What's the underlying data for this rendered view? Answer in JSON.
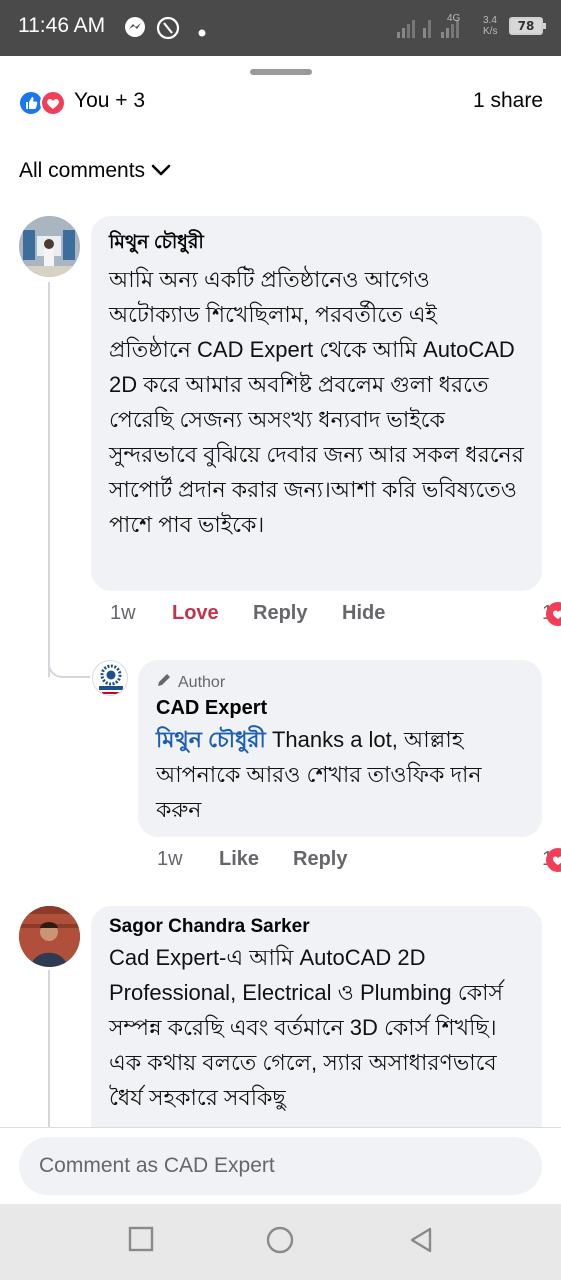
{
  "status_bar": {
    "time": "11:46 AM",
    "network_label": "4G",
    "speed": "3.4",
    "speed_unit": "K/s",
    "battery": "78"
  },
  "reactions": {
    "summary": "You + 3",
    "shares": "1 share"
  },
  "comments_filter": {
    "label": "All comments"
  },
  "comments": [
    {
      "author": "মিথুন চৌধুরী",
      "text": "আমি অন্য একটি প্রতিষ্ঠানেও আগেও অটোক্যাড শিখেছিলাম, পরবর্তীতে এই প্রতিষ্ঠানে CAD Expert থেকে আমি AutoCAD 2D করে আমার অবশিষ্ট প্রবলেম গুলা ধরতে পেরেছি সেজন্য অসংখ্য ধন্যবাদ ভাইকে  সুন্দরভাবে বুঝিয়ে দেবার জন্য আর সকল ধরনের সাপোর্ট প্রদান করার জন্য।আশা করি ভবিষ্যতেও পাশে পাব ভাইকে।",
      "time": "1w",
      "love": "Love",
      "reply": "Reply",
      "hide": "Hide",
      "reaction_count": "1"
    },
    {
      "badge": "Author",
      "author": "CAD Expert",
      "mention": "মিথুন চৌধুরী",
      "text": " Thanks a lot, আল্লাহ আপনাকে আরও শেখার তাওফিক দান করুন",
      "time": "1w",
      "like": "Like",
      "reply": "Reply",
      "reaction_count": "1"
    },
    {
      "author": "Sagor Chandra Sarker",
      "text": "Cad Expert-এ আমি AutoCAD 2D Professional, Electrical ও Plumbing কোর্স সম্পন্ন করেছি এবং বর্তমানে 3D কোর্স শিখছি। এক কথায় বলতে গেলে, স্যার অসাধারণভাবে ধৈর্য সহকারে সবকিছু"
    }
  ],
  "composer": {
    "placeholder": "Comment as CAD Expert"
  },
  "colors": {
    "like_blue": "#1877f2",
    "love_red": "#f33e58",
    "mention_blue": "#1a5fb4",
    "bubble_bg": "#f0f2f5"
  },
  "icons": [
    "messenger-icon",
    "status-circle-icon",
    "signal-icon",
    "battery-icon",
    "like-reaction-icon",
    "love-reaction-icon",
    "chevron-down-icon",
    "pencil-icon",
    "heart-icon",
    "recents-icon",
    "home-icon",
    "back-icon"
  ]
}
